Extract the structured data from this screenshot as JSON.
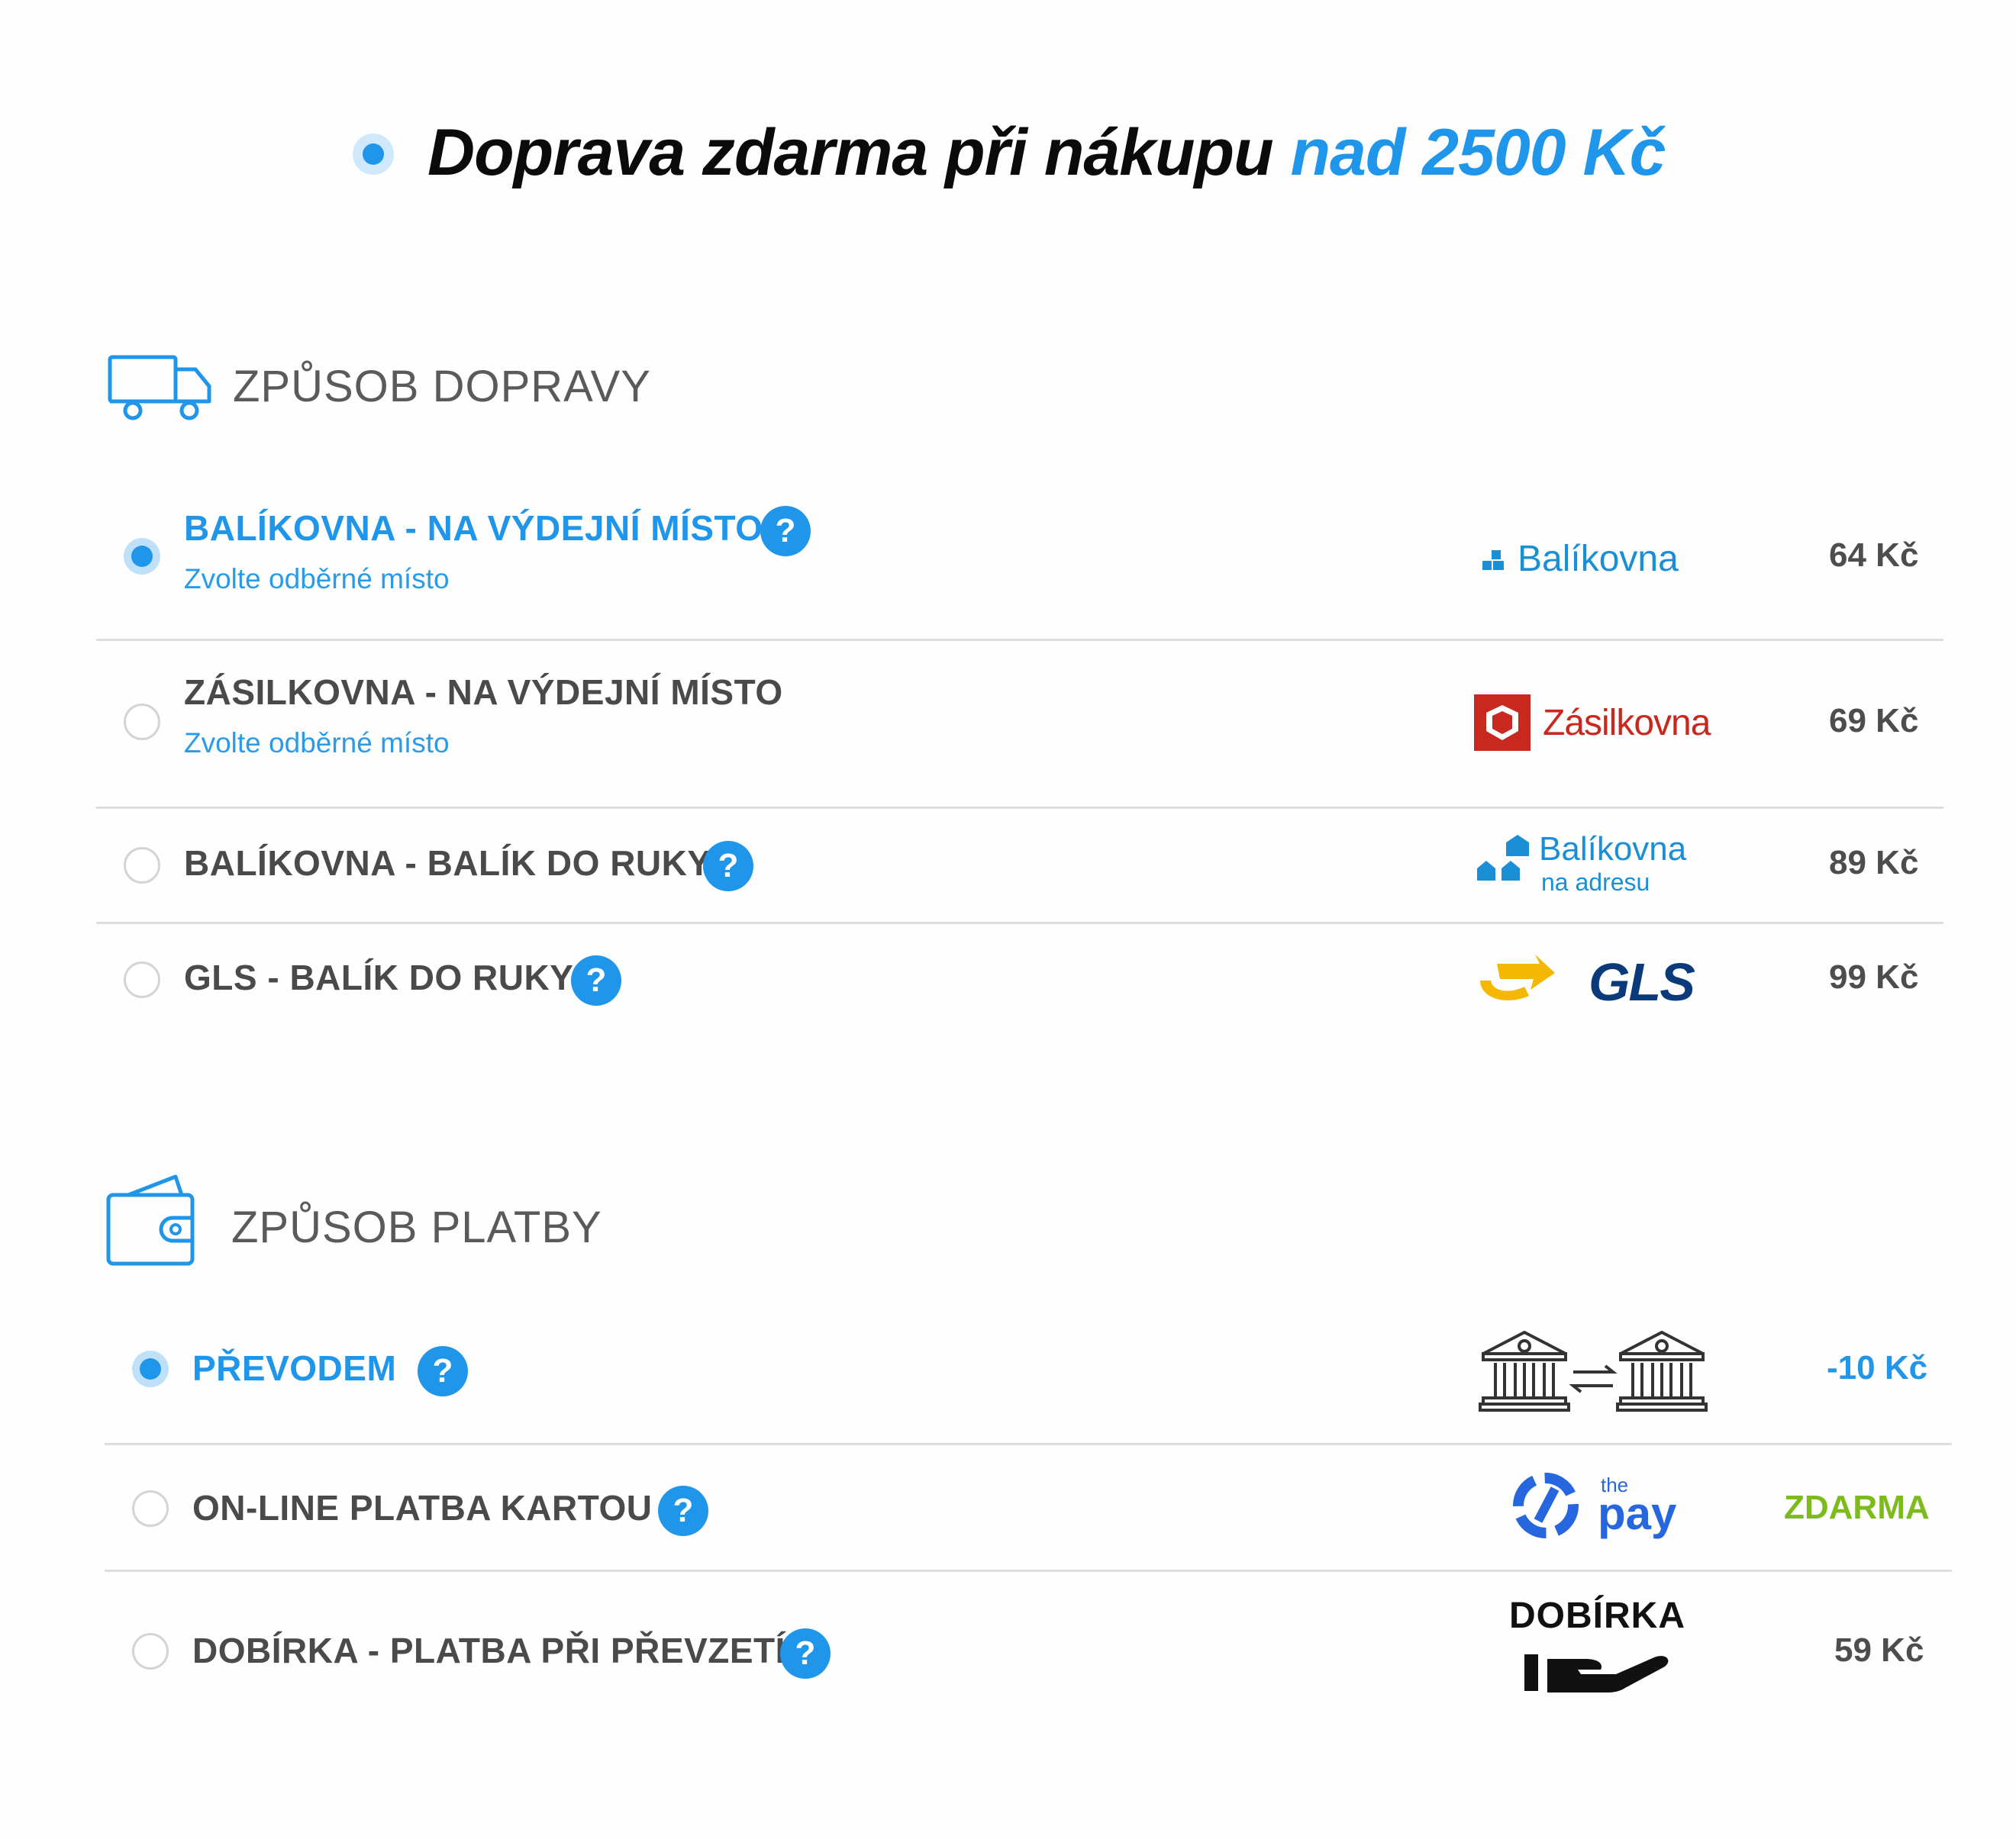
{
  "banner": {
    "text_main": "Doprava zdarma při nákupu ",
    "text_highlight": "nad 2500 Kč"
  },
  "shipping": {
    "title": "ZPŮSOB DOPRAVY",
    "icon": "truck-icon",
    "options": [
      {
        "label": "BALÍKOVNA - NA VÝDEJNÍ MÍSTO",
        "sub": "Zvolte odběrné místo",
        "logo_text": "Balíkovna",
        "price": "64 Kč",
        "selected": true
      },
      {
        "label": "ZÁSILKOVNA - NA VÝDEJNÍ MÍSTO",
        "sub": "Zvolte odběrné místo",
        "logo_text": "Zásilkovna",
        "price": "69 Kč",
        "selected": false
      },
      {
        "label": "BALÍKOVNA - BALÍK DO RUKY",
        "logo_text": "Balíkovna",
        "logo_sub": "na adresu",
        "price": "89 Kč",
        "selected": false
      },
      {
        "label": "GLS - BALÍK DO RUKY",
        "logo_text": "GLS",
        "price": "99 Kč",
        "selected": false
      }
    ]
  },
  "payment": {
    "title": "ZPŮSOB PLATBY",
    "icon": "wallet-icon",
    "options": [
      {
        "label": "PŘEVODEM",
        "price": "-10 Kč",
        "selected": true
      },
      {
        "label": "ON-LINE PLATBA KARTOU",
        "logo_small": "the",
        "logo_text": "pay",
        "price": "ZDARMA",
        "selected": false
      },
      {
        "label": "DOBÍRKA - PLATBA PŘI PŘEVZETÍ",
        "logo_text": "DOBÍRKA",
        "price": "59 Kč",
        "selected": false
      }
    ]
  },
  "help_glyph": "?",
  "colors": {
    "accent": "#1f96ea",
    "text": "#4a4a4a",
    "free": "#7dbb1c",
    "zasilkovna_red": "#c8281e",
    "gls_yellow": "#f5b800",
    "gls_blue": "#0a3a7a"
  }
}
